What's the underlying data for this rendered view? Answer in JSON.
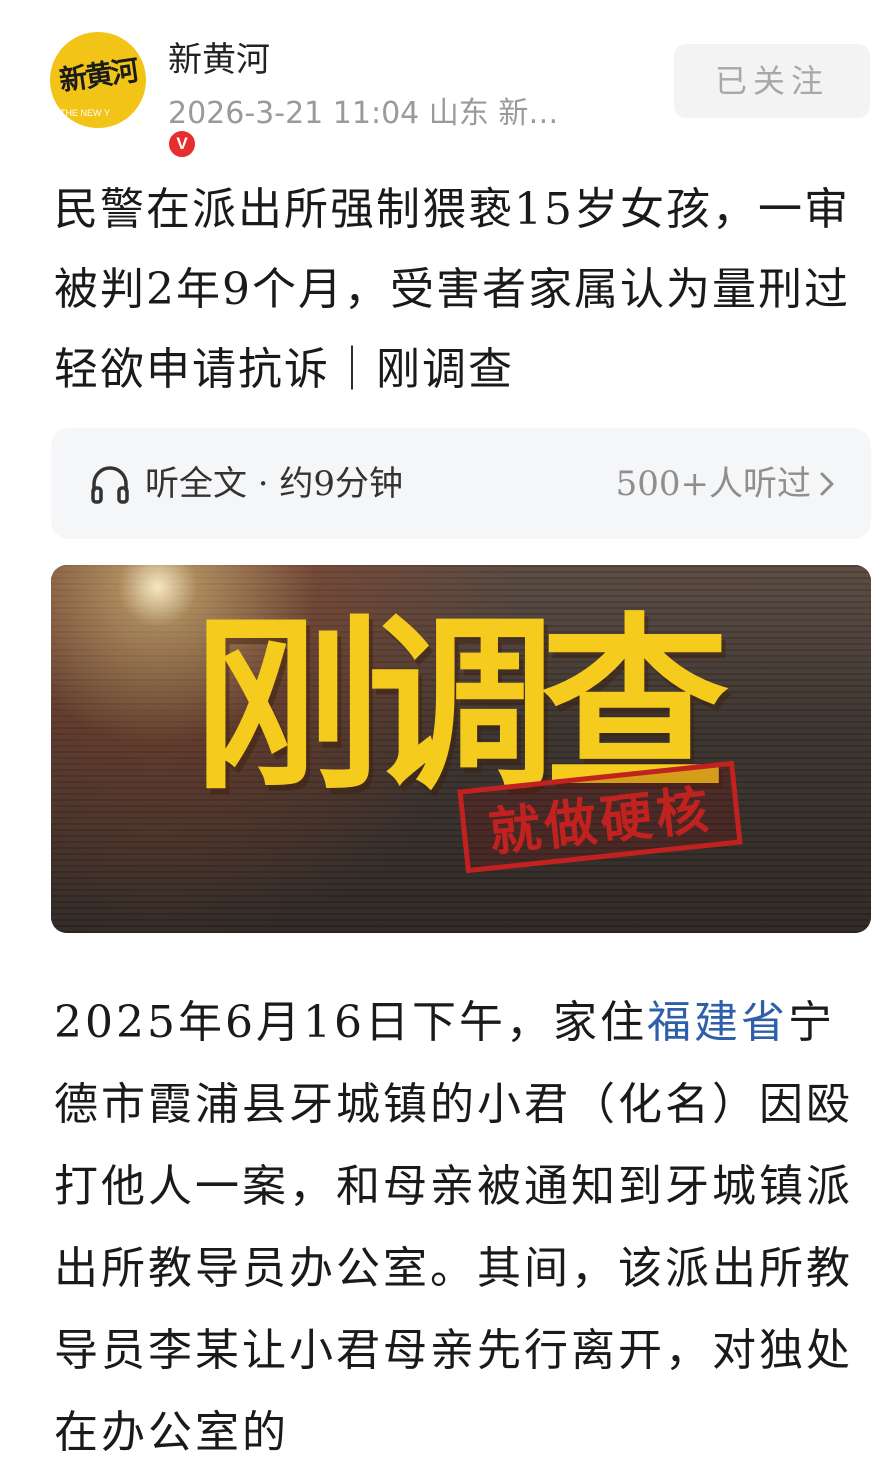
{
  "header": {
    "avatar_logo_text": "新黄河",
    "avatar_sub_text": "THE NEW Y",
    "verified_mark": "V",
    "account_name": "新黄河",
    "meta": "2026-3-21 11:04  山东  新…",
    "follow_button": "已关注"
  },
  "article": {
    "title": "民警在派出所强制猥亵15岁女孩，一审被判2年9个月，受害者家属认为量刑过轻欲申请抗诉｜刚调查"
  },
  "listen": {
    "label": "听全文 · 约9分钟",
    "count": "500+人听过"
  },
  "hero": {
    "title": "刚调查",
    "stamp": "就做硬核"
  },
  "body": {
    "p1_before_link": "2025年6月16日下午，家住",
    "p1_link": "福建省",
    "p1_after_link": "宁德市霞浦县牙城镇的小君（化名）因殴打他人一案，和母亲被通知到牙城镇派出所教导员办公室。其间，该派出所教导员李某让小君母亲先行离开，对独处在办公室的"
  },
  "icons": {
    "headphone": "headphone-icon",
    "chevron": "chevron-right-icon",
    "verified": "verified-icon"
  },
  "colors": {
    "avatar_bg": "#f2c417",
    "verified_bg": "#e62e2e",
    "link": "#2f5fa8",
    "hero_title": "#f5cc1d",
    "stamp": "#c2221f"
  }
}
